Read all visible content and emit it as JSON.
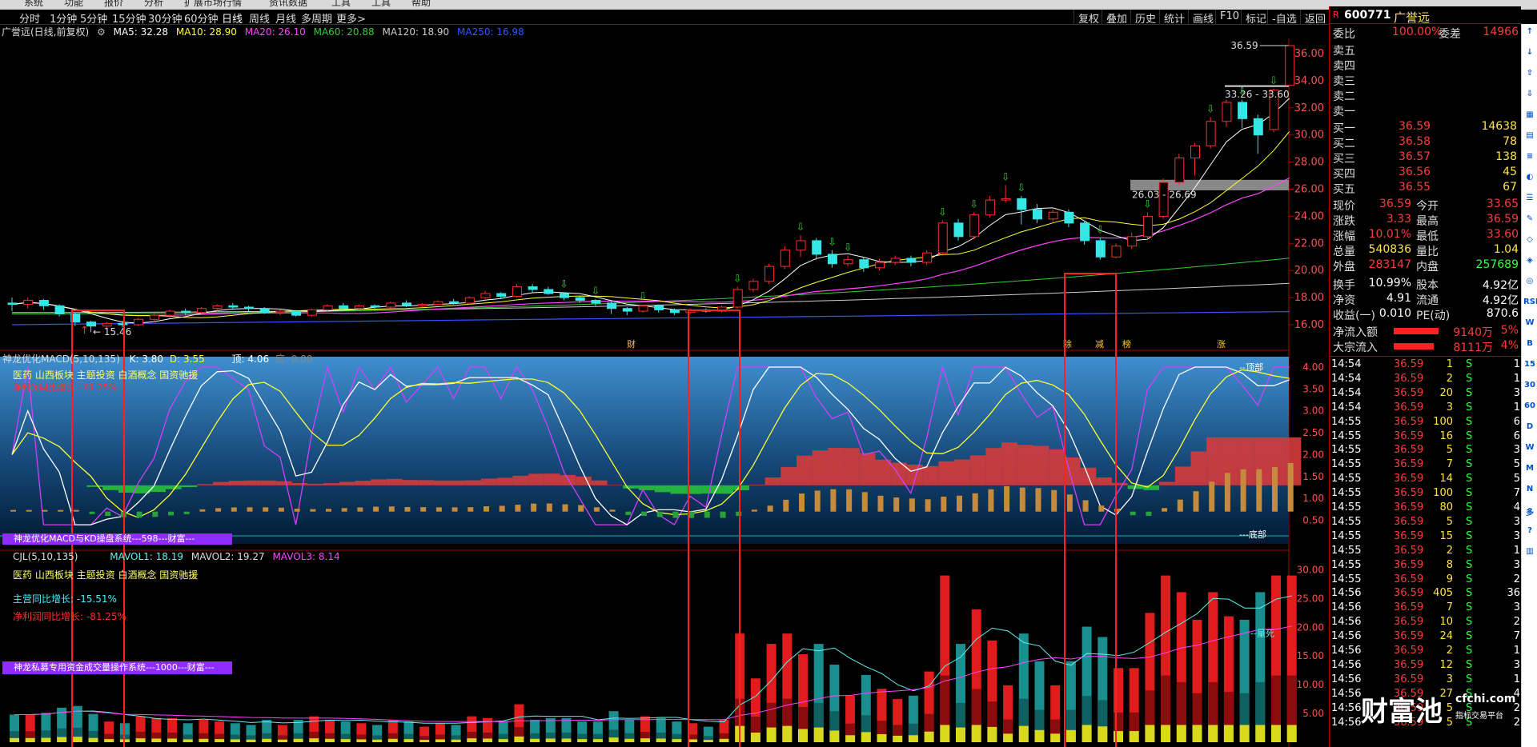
{
  "menu": {
    "items": [
      "系统",
      "功能",
      "报价",
      "分析",
      "扩展市场行情",
      "资讯数据",
      "工具",
      "工具",
      "帮助"
    ]
  },
  "period_tabs": [
    "分时",
    "1分钟",
    "5分钟",
    "15分钟",
    "30分钟",
    "60分钟",
    "日线",
    "周线",
    "月线",
    "多周期",
    "更多>"
  ],
  "active_period": "日线",
  "toolbar": [
    "复权",
    "叠加",
    "历史",
    "统计",
    "画线",
    "F10",
    "标记",
    "-自选",
    "返回"
  ],
  "stock": {
    "name_label": "广誉远(日线,前复权)",
    "ma": {
      "ma5": "MA5: 32.28",
      "ma10": "MA10: 28.90",
      "ma20": "MA20: 26.10",
      "ma60": "MA60: 20.88",
      "ma120": "MA120: 18.90",
      "ma250": "MA250: 16.98"
    }
  },
  "price_axis": [
    "36.00",
    "34.00",
    "32.00",
    "30.00",
    "28.00",
    "26.00",
    "24.00",
    "22.00",
    "20.00",
    "18.00",
    "16.00"
  ],
  "price_annotations": {
    "high": "36.59",
    "low": "15.46",
    "zone1": "33.26 - 33.60",
    "zone2": "26.03 - 26.69"
  },
  "event_labels": [
    "财",
    "除",
    "减",
    "榜",
    "涨"
  ],
  "macd_panel": {
    "title": "神龙优化MACD(5,10,135)",
    "k": "K: 3.80",
    "d": "D: 3.55",
    "top": "顶: 4.06",
    "bottom": "底: 0.00",
    "axis": [
      "4.00",
      "3.50",
      "3.00",
      "2.50",
      "2.00",
      "1.50",
      "1.00",
      "0.50"
    ],
    "sector": "医药 山西板块 主题投资 白酒概念 国资驰援",
    "profit": "净利润同比增长: -81.25%",
    "banner": "神龙优化MACD与KD操盘系统---598---财富---",
    "top_label": "--顶部",
    "bottom_label": "---底部"
  },
  "vol_panel": {
    "title": "CJL(5,10,135)",
    "mavol1": "MAVOL1: 18.19",
    "mavol2": "MAVOL2: 19.27",
    "mavol3": "MAVOL3: 8.14",
    "sector": "医药 山西板块 主题投资 白酒概念 国资驰援",
    "main_growth": "主营同比增长: -15.51%",
    "profit": "净利润同比增长: -81.25%",
    "banner": "神龙私募专用资金成交量操作系统---1000---财富---",
    "axis": [
      "30.00",
      "25.00",
      "20.00",
      "15.00",
      "10.00",
      "5.00"
    ],
    "dead_label": "--量死"
  },
  "quote": {
    "code": "600771",
    "name": "广誉远",
    "webi_label": "委比",
    "webi": "100.00%",
    "wecha_label": "委差",
    "wecha": "14966",
    "sells": [
      {
        "label": "卖五",
        "price": "",
        "vol": ""
      },
      {
        "label": "卖四",
        "price": "",
        "vol": ""
      },
      {
        "label": "卖三",
        "price": "",
        "vol": ""
      },
      {
        "label": "卖二",
        "price": "",
        "vol": ""
      },
      {
        "label": "卖一",
        "price": "",
        "vol": ""
      }
    ],
    "buys": [
      {
        "label": "买一",
        "price": "36.59",
        "vol": "14638"
      },
      {
        "label": "买二",
        "price": "36.58",
        "vol": "78"
      },
      {
        "label": "买三",
        "price": "36.57",
        "vol": "138"
      },
      {
        "label": "买四",
        "price": "36.56",
        "vol": "45"
      },
      {
        "label": "买五",
        "price": "36.55",
        "vol": "67"
      }
    ],
    "stats": [
      {
        "l1": "现价",
        "v1": "36.59",
        "c1": "red",
        "l2": "今开",
        "v2": "33.65",
        "c2": "red"
      },
      {
        "l1": "涨跌",
        "v1": "3.33",
        "c1": "red",
        "l2": "最高",
        "v2": "36.59",
        "c2": "red"
      },
      {
        "l1": "涨幅",
        "v1": "10.01%",
        "c1": "red",
        "l2": "最低",
        "v2": "33.60",
        "c2": "red"
      },
      {
        "l1": "总量",
        "v1": "540836",
        "c1": "yel",
        "l2": "量比",
        "v2": "1.04",
        "c2": "yel"
      },
      {
        "l1": "外盘",
        "v1": "283147",
        "c1": "red",
        "l2": "内盘",
        "v2": "257689",
        "c2": "grn"
      }
    ],
    "stats2": [
      {
        "l1": "换手",
        "v1": "10.99%",
        "l2": "股本",
        "v2": "4.92亿"
      },
      {
        "l1": "净资",
        "v1": "4.91",
        "l2": "流通",
        "v2": "4.92亿"
      },
      {
        "l1": "收益(一)",
        "v1": "0.010",
        "l2": "PE(动)",
        "v2": "870.6"
      }
    ],
    "flows": [
      {
        "label": "净流入额",
        "value": "9140万",
        "pct": "5%"
      },
      {
        "label": "大宗流入",
        "value": "8111万",
        "pct": "4%"
      }
    ]
  },
  "ticks": [
    {
      "t": "14:54",
      "p": "36.59",
      "v": "1",
      "s": "S",
      "n": "1"
    },
    {
      "t": "14:54",
      "p": "36.59",
      "v": "2",
      "s": "S",
      "n": "1"
    },
    {
      "t": "14:54",
      "p": "36.59",
      "v": "20",
      "s": "S",
      "n": "3"
    },
    {
      "t": "14:54",
      "p": "36.59",
      "v": "3",
      "s": "S",
      "n": "1"
    },
    {
      "t": "14:55",
      "p": "36.59",
      "v": "100",
      "s": "S",
      "n": "6"
    },
    {
      "t": "14:55",
      "p": "36.59",
      "v": "16",
      "s": "S",
      "n": "6"
    },
    {
      "t": "14:55",
      "p": "36.59",
      "v": "5",
      "s": "S",
      "n": "3"
    },
    {
      "t": "14:55",
      "p": "36.59",
      "v": "7",
      "s": "S",
      "n": "5"
    },
    {
      "t": "14:55",
      "p": "36.59",
      "v": "14",
      "s": "S",
      "n": "5"
    },
    {
      "t": "14:55",
      "p": "36.59",
      "v": "100",
      "s": "S",
      "n": "7"
    },
    {
      "t": "14:55",
      "p": "36.59",
      "v": "80",
      "s": "S",
      "n": "4"
    },
    {
      "t": "14:55",
      "p": "36.59",
      "v": "5",
      "s": "S",
      "n": "3"
    },
    {
      "t": "14:55",
      "p": "36.59",
      "v": "15",
      "s": "S",
      "n": "3"
    },
    {
      "t": "14:55",
      "p": "36.59",
      "v": "2",
      "s": "S",
      "n": "1"
    },
    {
      "t": "14:55",
      "p": "36.59",
      "v": "8",
      "s": "S",
      "n": "3"
    },
    {
      "t": "14:55",
      "p": "36.59",
      "v": "9",
      "s": "S",
      "n": "2"
    },
    {
      "t": "14:56",
      "p": "36.59",
      "v": "405",
      "s": "S",
      "n": "36"
    },
    {
      "t": "14:56",
      "p": "36.59",
      "v": "7",
      "s": "S",
      "n": "3"
    },
    {
      "t": "14:56",
      "p": "36.59",
      "v": "10",
      "s": "S",
      "n": "2"
    },
    {
      "t": "14:56",
      "p": "36.59",
      "v": "24",
      "s": "S",
      "n": "7"
    },
    {
      "t": "14:56",
      "p": "36.59",
      "v": "2",
      "s": "S",
      "n": "1"
    },
    {
      "t": "14:56",
      "p": "36.59",
      "v": "12",
      "s": "S",
      "n": "3"
    },
    {
      "t": "14:56",
      "p": "36.59",
      "v": "3",
      "s": "S",
      "n": "1"
    },
    {
      "t": "14:56",
      "p": "36.59",
      "v": "27",
      "s": "S",
      "n": "4"
    },
    {
      "t": "14:56",
      "p": "36.59",
      "v": "5",
      "s": "S",
      "n": "2"
    },
    {
      "t": "14:56",
      "p": "36.59",
      "v": "5",
      "s": "S",
      "n": "2"
    }
  ],
  "side_icons": [
    "↑",
    "↓",
    "⇧",
    "⇩",
    "▦",
    "▤",
    "≡",
    "◐",
    "☰",
    "✎",
    "◇",
    "◈",
    "◎",
    "RSI",
    "W",
    "B",
    "15",
    "30",
    "60",
    "D",
    "W",
    "M",
    "N",
    "多",
    "?",
    "▥"
  ],
  "watermark": {
    "brand": "财富池",
    "site": "cfchi.com",
    "slogan": "指标交易平台"
  },
  "colors": {
    "up": "#ff2d2d",
    "down": "#35e6e6",
    "ma5": "#ffffff",
    "ma10": "#ffff33",
    "ma20": "#ff44ff",
    "ma60": "#33cc33",
    "ma120": "#cccccc",
    "ma250": "#3355ff",
    "box": "#ff2020"
  },
  "chart_data": {
    "type": "candlestick",
    "ylim": [
      15,
      37
    ],
    "candles": [
      [
        17.6,
        17.5,
        17.0,
        18.0
      ],
      [
        17.5,
        17.8,
        17.2,
        18.0
      ],
      [
        17.8,
        17.4,
        17.1,
        17.9
      ],
      [
        17.4,
        16.8,
        16.6,
        17.5
      ],
      [
        16.8,
        16.2,
        15.9,
        16.9
      ],
      [
        16.2,
        15.9,
        15.46,
        16.3
      ],
      [
        15.9,
        16.1,
        15.7,
        16.2
      ],
      [
        16.1,
        16.0,
        15.8,
        16.3
      ],
      [
        16.0,
        16.4,
        15.9,
        16.5
      ],
      [
        16.4,
        16.7,
        16.2,
        16.8
      ],
      [
        16.7,
        17.0,
        16.5,
        17.1
      ],
      [
        17.0,
        16.9,
        16.7,
        17.2
      ],
      [
        16.9,
        17.2,
        16.8,
        17.3
      ],
      [
        17.2,
        17.4,
        17.0,
        17.5
      ],
      [
        17.4,
        17.3,
        17.1,
        17.6
      ],
      [
        17.3,
        17.2,
        17.0,
        17.4
      ],
      [
        17.2,
        16.9,
        16.8,
        17.3
      ],
      [
        16.9,
        17.0,
        16.7,
        17.1
      ],
      [
        17.0,
        16.7,
        16.6,
        17.1
      ],
      [
        16.7,
        17.1,
        16.6,
        17.2
      ],
      [
        17.1,
        17.4,
        17.0,
        17.5
      ],
      [
        17.4,
        17.2,
        17.1,
        17.6
      ],
      [
        17.2,
        17.4,
        17.1,
        17.5
      ],
      [
        17.4,
        17.3,
        17.1,
        17.5
      ],
      [
        17.3,
        17.6,
        17.2,
        17.7
      ],
      [
        17.6,
        17.4,
        17.3,
        17.8
      ],
      [
        17.4,
        17.5,
        17.3,
        17.6
      ],
      [
        17.5,
        17.7,
        17.4,
        17.8
      ],
      [
        17.7,
        17.6,
        17.5,
        17.9
      ],
      [
        17.6,
        18.0,
        17.5,
        18.1
      ],
      [
        18.0,
        18.3,
        17.9,
        18.5
      ],
      [
        18.3,
        18.1,
        17.9,
        18.4
      ],
      [
        18.1,
        18.8,
        18.0,
        19.0
      ],
      [
        18.8,
        18.6,
        18.4,
        19.0
      ],
      [
        18.6,
        18.3,
        18.2,
        18.8
      ],
      [
        18.3,
        18.0,
        17.8,
        18.4
      ],
      [
        18.0,
        17.8,
        17.6,
        18.1
      ],
      [
        17.8,
        17.6,
        17.4,
        17.9
      ],
      [
        17.6,
        17.2,
        16.8,
        17.7
      ],
      [
        17.2,
        17.0,
        16.7,
        17.3
      ],
      [
        17.0,
        17.4,
        16.9,
        17.5
      ],
      [
        17.4,
        17.1,
        16.9,
        17.5
      ],
      [
        17.1,
        16.9,
        16.7,
        17.2
      ],
      [
        16.9,
        17.1,
        16.8,
        17.2
      ],
      [
        17.1,
        17.0,
        16.9,
        17.2
      ],
      [
        17.0,
        17.3,
        16.9,
        17.4
      ],
      [
        17.3,
        18.6,
        17.2,
        18.8
      ],
      [
        18.6,
        19.2,
        18.4,
        19.4
      ],
      [
        19.2,
        20.3,
        19.0,
        20.5
      ],
      [
        20.3,
        21.5,
        20.1,
        21.8
      ],
      [
        21.5,
        22.2,
        21.0,
        22.6
      ],
      [
        22.2,
        21.2,
        20.8,
        22.4
      ],
      [
        21.2,
        20.5,
        20.2,
        21.5
      ],
      [
        20.5,
        20.8,
        20.3,
        21.1
      ],
      [
        20.8,
        20.2,
        19.9,
        21.0
      ],
      [
        20.2,
        20.6,
        20.0,
        20.9
      ],
      [
        20.6,
        20.9,
        20.4,
        21.1
      ],
      [
        20.9,
        20.6,
        20.3,
        21.1
      ],
      [
        20.6,
        21.3,
        20.4,
        21.5
      ],
      [
        21.3,
        23.5,
        21.1,
        23.7
      ],
      [
        23.5,
        22.5,
        22.2,
        23.8
      ],
      [
        22.5,
        24.1,
        22.3,
        24.3
      ],
      [
        24.1,
        25.2,
        23.9,
        25.5
      ],
      [
        25.2,
        25.3,
        25.0,
        26.3
      ],
      [
        25.3,
        24.5,
        23.4,
        25.5
      ],
      [
        24.5,
        23.8,
        23.5,
        24.9
      ],
      [
        23.8,
        24.3,
        23.6,
        24.5
      ],
      [
        24.3,
        23.5,
        23.2,
        24.5
      ],
      [
        23.5,
        22.2,
        21.9,
        23.7
      ],
      [
        22.2,
        21.0,
        20.8,
        22.4
      ],
      [
        21.0,
        21.8,
        20.9,
        22.0
      ],
      [
        21.8,
        22.5,
        21.6,
        22.8
      ],
      [
        22.5,
        24.0,
        22.3,
        24.3
      ],
      [
        24.0,
        26.5,
        23.8,
        26.8
      ],
      [
        26.5,
        28.3,
        26.3,
        28.6
      ],
      [
        28.3,
        29.2,
        27.0,
        29.4
      ],
      [
        29.2,
        31.0,
        29.0,
        31.3
      ],
      [
        31.0,
        32.4,
        30.6,
        32.6
      ],
      [
        32.4,
        31.2,
        30.5,
        32.6
      ],
      [
        31.2,
        30.0,
        28.6,
        31.5
      ],
      [
        30.4,
        33.3,
        30.2,
        33.4
      ],
      [
        33.65,
        36.59,
        33.6,
        36.59
      ]
    ]
  }
}
